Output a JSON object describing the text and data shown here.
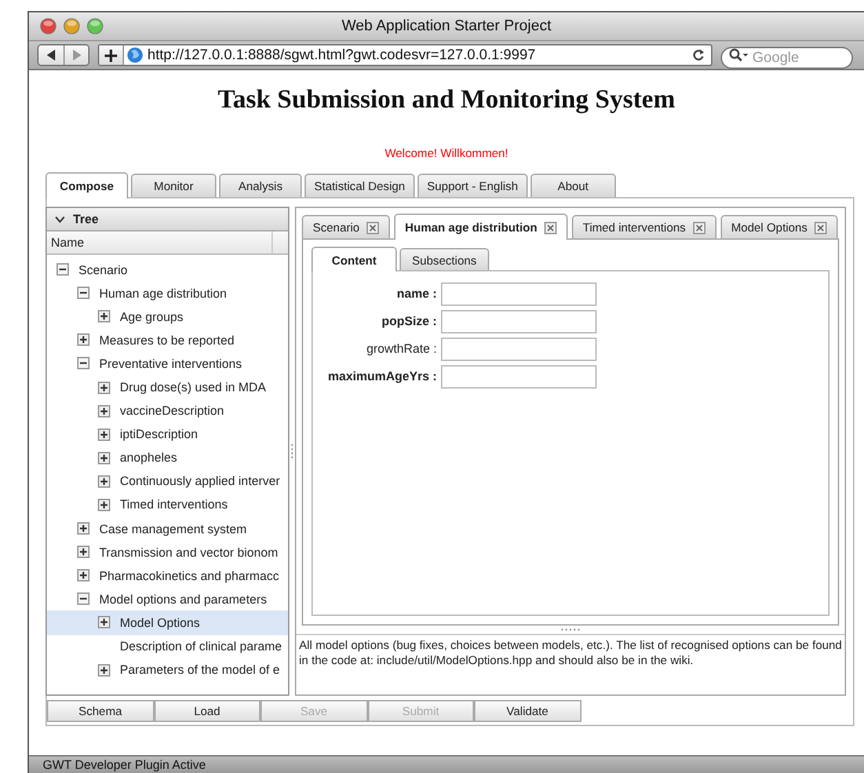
{
  "window": {
    "title": "Web Application Starter Project"
  },
  "toolbar": {
    "url": "http://127.0.0.1:8888/sgwt.html?gwt.codesvr=127.0.0.1:9997",
    "search_placeholder": "Google"
  },
  "page": {
    "heading": "Task Submission and Monitoring System",
    "welcome": "Welcome! Willkommen!"
  },
  "tabs": [
    {
      "label": "Compose",
      "selected": true
    },
    {
      "label": "Monitor",
      "selected": false
    },
    {
      "label": "Analysis",
      "selected": false
    },
    {
      "label": "Statistical Design",
      "selected": false
    },
    {
      "label": "Support - English",
      "selected": false
    },
    {
      "label": "About",
      "selected": false
    }
  ],
  "tree": {
    "title": "Tree",
    "column": "Name",
    "nodes": [
      {
        "label": "Scenario",
        "kind": "branch",
        "expanded": true,
        "selected": false,
        "children": [
          {
            "label": "Human age distribution",
            "kind": "branch",
            "expanded": true,
            "selected": false,
            "children": [
              {
                "label": "Age groups",
                "kind": "branch",
                "expanded": false,
                "selected": false
              }
            ]
          },
          {
            "label": "Measures to be reported",
            "kind": "branch",
            "expanded": false,
            "selected": false
          },
          {
            "label": "Preventative interventions",
            "kind": "branch",
            "expanded": true,
            "selected": false,
            "children": [
              {
                "label": "Drug dose(s) used in MDA",
                "kind": "branch",
                "expanded": false,
                "selected": false
              },
              {
                "label": "vaccineDescription",
                "kind": "branch",
                "expanded": false,
                "selected": false
              },
              {
                "label": "iptiDescription",
                "kind": "branch",
                "expanded": false,
                "selected": false
              },
              {
                "label": "anopheles",
                "kind": "branch",
                "expanded": false,
                "selected": false
              },
              {
                "label": "Continuously applied interver",
                "kind": "branch",
                "expanded": false,
                "selected": false
              },
              {
                "label": "Timed interventions",
                "kind": "branch",
                "expanded": false,
                "selected": false
              }
            ]
          },
          {
            "label": "Case management system",
            "kind": "branch",
            "expanded": false,
            "selected": false
          },
          {
            "label": "Transmission and vector bionom",
            "kind": "branch",
            "expanded": false,
            "selected": false
          },
          {
            "label": "Pharmacokinetics and pharmacc",
            "kind": "branch",
            "expanded": false,
            "selected": false
          },
          {
            "label": "Model options and parameters",
            "kind": "branch",
            "expanded": true,
            "selected": false,
            "children": [
              {
                "label": "Model Options",
                "kind": "branch",
                "expanded": false,
                "selected": true
              },
              {
                "label": "Description of clinical parame",
                "kind": "leaf",
                "selected": false
              },
              {
                "label": "Parameters of the model of e",
                "kind": "branch",
                "expanded": false,
                "selected": false
              }
            ]
          }
        ]
      }
    ]
  },
  "editor": {
    "tabs": [
      {
        "label": "Scenario",
        "selected": false
      },
      {
        "label": "Human age distribution",
        "selected": true
      },
      {
        "label": "Timed interventions",
        "selected": false
      },
      {
        "label": "Model Options",
        "selected": false
      }
    ],
    "subtabs": [
      {
        "label": "Content",
        "selected": true
      },
      {
        "label": "Subsections",
        "selected": false
      }
    ],
    "fields": [
      {
        "label": "name :",
        "required": true
      },
      {
        "label": "popSize :",
        "required": true
      },
      {
        "label": "growthRate :",
        "required": false
      },
      {
        "label": "maximumAgeYrs :",
        "required": true
      }
    ],
    "description": "All model options (bug fixes, choices between models, etc.). The list of recognised options can be found in the code at: include/util/ModelOptions.hpp and should also be in the wiki."
  },
  "buttons": [
    {
      "label": "Schema",
      "disabled": false
    },
    {
      "label": "Load",
      "disabled": false
    },
    {
      "label": "Save",
      "disabled": true
    },
    {
      "label": "Submit",
      "disabled": true
    },
    {
      "label": "Validate",
      "disabled": false
    }
  ],
  "status_bar": "GWT Developer Plugin Active"
}
